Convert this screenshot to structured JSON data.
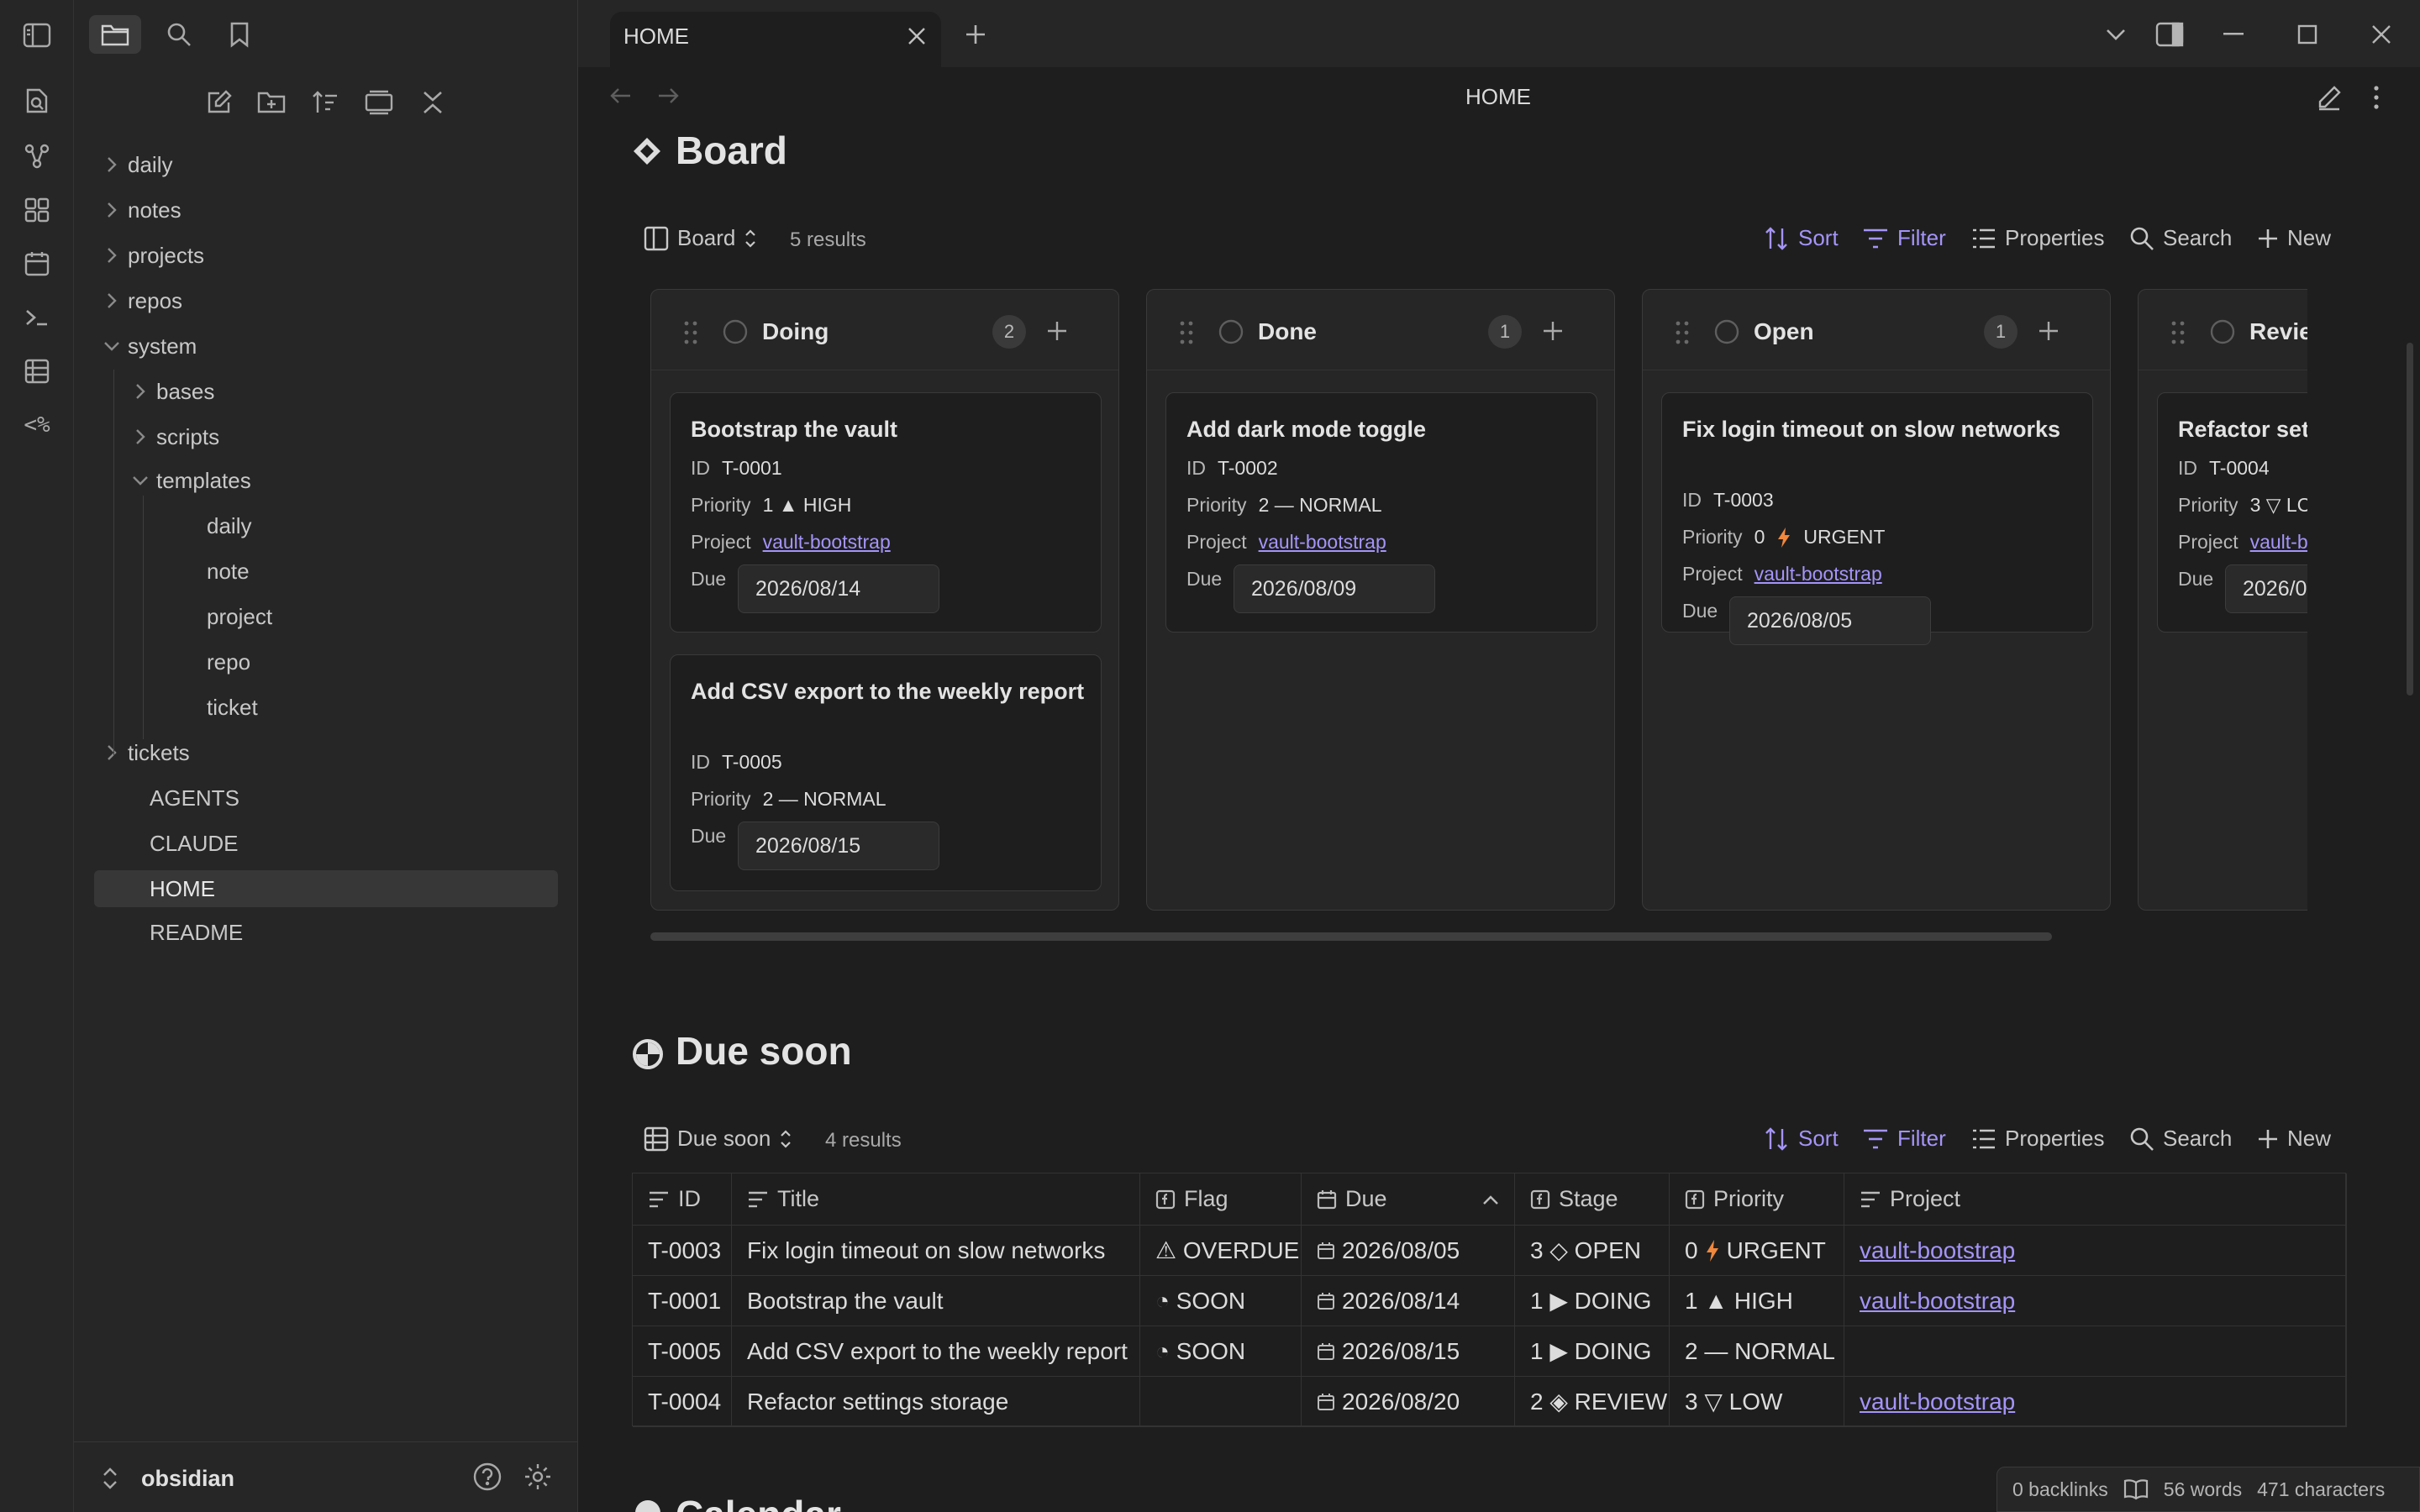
{
  "tab": {
    "title": "HOME"
  },
  "header": {
    "title": "HOME"
  },
  "sidebar": {
    "tree": [
      {
        "label": "daily"
      },
      {
        "label": "notes"
      },
      {
        "label": "projects"
      },
      {
        "label": "repos"
      },
      {
        "label": "system"
      },
      {
        "label": "bases"
      },
      {
        "label": "scripts"
      },
      {
        "label": "templates"
      },
      {
        "label": "daily"
      },
      {
        "label": "note"
      },
      {
        "label": "project"
      },
      {
        "label": "repo"
      },
      {
        "label": "ticket"
      },
      {
        "label": "tickets"
      },
      {
        "label": "AGENTS"
      },
      {
        "label": "CLAUDE"
      },
      {
        "label": "HOME"
      },
      {
        "label": "README"
      }
    ],
    "vault": "obsidian"
  },
  "board": {
    "heading": "Board",
    "view_name": "Board",
    "results": "5 results",
    "toolbar": {
      "sort": "Sort",
      "filter": "Filter",
      "properties": "Properties",
      "search": "Search",
      "new": "New"
    },
    "columns": [
      {
        "name": "Doing",
        "count": "2"
      },
      {
        "name": "Done",
        "count": "1"
      },
      {
        "name": "Open",
        "count": "1"
      },
      {
        "name": "Revie",
        "count": ""
      }
    ],
    "prop_labels": {
      "id": "ID",
      "priority": "Priority",
      "project": "Project",
      "due": "Due"
    },
    "cards": [
      {
        "title": "Bootstrap the vault",
        "id": "T-0001",
        "priority": "1 ▲ HIGH",
        "project": "vault-bootstrap",
        "due": "2026/08/14"
      },
      {
        "title": "Add CSV export to the weekly report",
        "id": "T-0005",
        "priority": "2 — NORMAL",
        "project": "",
        "due": "2026/08/15"
      },
      {
        "title": "Add dark mode toggle",
        "id": "T-0002",
        "priority": "2 — NORMAL",
        "project": "vault-bootstrap",
        "due": "2026/08/09"
      },
      {
        "title": "Fix login timeout on slow networks",
        "id": "T-0003",
        "priority": "0",
        "priority_label": "URGENT",
        "project": "vault-bootstrap",
        "due": "2026/08/05"
      },
      {
        "title": "Refactor sett",
        "id": "T-0004",
        "priority": "3 ▽ LC",
        "project": "vault-b",
        "due": "2026/0"
      }
    ]
  },
  "due_soon": {
    "heading": "Due soon",
    "view_name": "Due soon",
    "results": "4 results",
    "toolbar": {
      "sort": "Sort",
      "filter": "Filter",
      "properties": "Properties",
      "search": "Search",
      "new": "New"
    },
    "columns": [
      "ID",
      "Title",
      "Flag",
      "Due",
      "Stage",
      "Priority",
      "Project"
    ],
    "rows": [
      {
        "id": "T-0003",
        "title": "Fix login timeout on slow networks",
        "flag": "⚠ OVERDUE",
        "due": "2026/08/05",
        "stage": "3 ◇ OPEN",
        "priority": "0",
        "priority_label": "URGENT",
        "project": "vault-bootstrap"
      },
      {
        "id": "T-0001",
        "title": "Bootstrap the vault",
        "flag": "◔ SOON",
        "due": "2026/08/14",
        "stage": "1 ▶ DOING",
        "priority": "1 ▲ HIGH",
        "project": "vault-bootstrap"
      },
      {
        "id": "T-0005",
        "title": "Add CSV export to the weekly report",
        "flag": "◔ SOON",
        "due": "2026/08/15",
        "stage": "1 ▶ DOING",
        "priority": "2 — NORMAL",
        "project": ""
      },
      {
        "id": "T-0004",
        "title": "Refactor settings storage",
        "flag": "",
        "due": "2026/08/20",
        "stage": "2 ◈ REVIEW",
        "priority": "3 ▽ LOW",
        "project": "vault-bootstrap"
      }
    ]
  },
  "next_heading": "Calendar",
  "status": {
    "backlinks": "0 backlinks",
    "words": "56 words",
    "characters": "471 characters"
  },
  "colors": {
    "accent": "#a594f9",
    "urgent": "#f0883e"
  }
}
